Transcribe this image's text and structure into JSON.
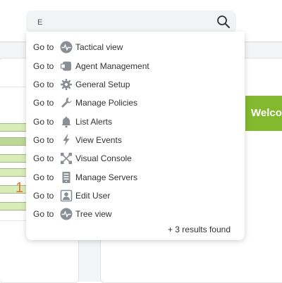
{
  "search": {
    "value": "E",
    "icon": "search-icon"
  },
  "results": [
    {
      "prefix": "Go to",
      "label": "Tactical view",
      "icon": "pulse-icon"
    },
    {
      "prefix": "Go to",
      "label": "Agent Management",
      "icon": "agent-icon"
    },
    {
      "prefix": "Go to",
      "label": "General Setup",
      "icon": "gear-icon"
    },
    {
      "prefix": "Go to",
      "label": "Manage Policies",
      "icon": "wrench-icon"
    },
    {
      "prefix": "Go to",
      "label": "List Alerts",
      "icon": "bell-icon"
    },
    {
      "prefix": "Go to",
      "label": "View Events",
      "icon": "lightning-icon"
    },
    {
      "prefix": "Go to",
      "label": "Visual Console",
      "icon": "network-icon"
    },
    {
      "prefix": "Go to",
      "label": "Manage Servers",
      "icon": "server-icon"
    },
    {
      "prefix": "Go to",
      "label": "Edit User",
      "icon": "user-icon"
    },
    {
      "prefix": "Go to",
      "label": "Tree view",
      "icon": "pulse-icon"
    }
  ],
  "footer": "+ 3 results found",
  "background": {
    "count_value": "1",
    "welcome_text": "Welco"
  },
  "colors": {
    "accent": "#82b92e",
    "count": "#e8702a",
    "icon": "#8a8f96"
  }
}
